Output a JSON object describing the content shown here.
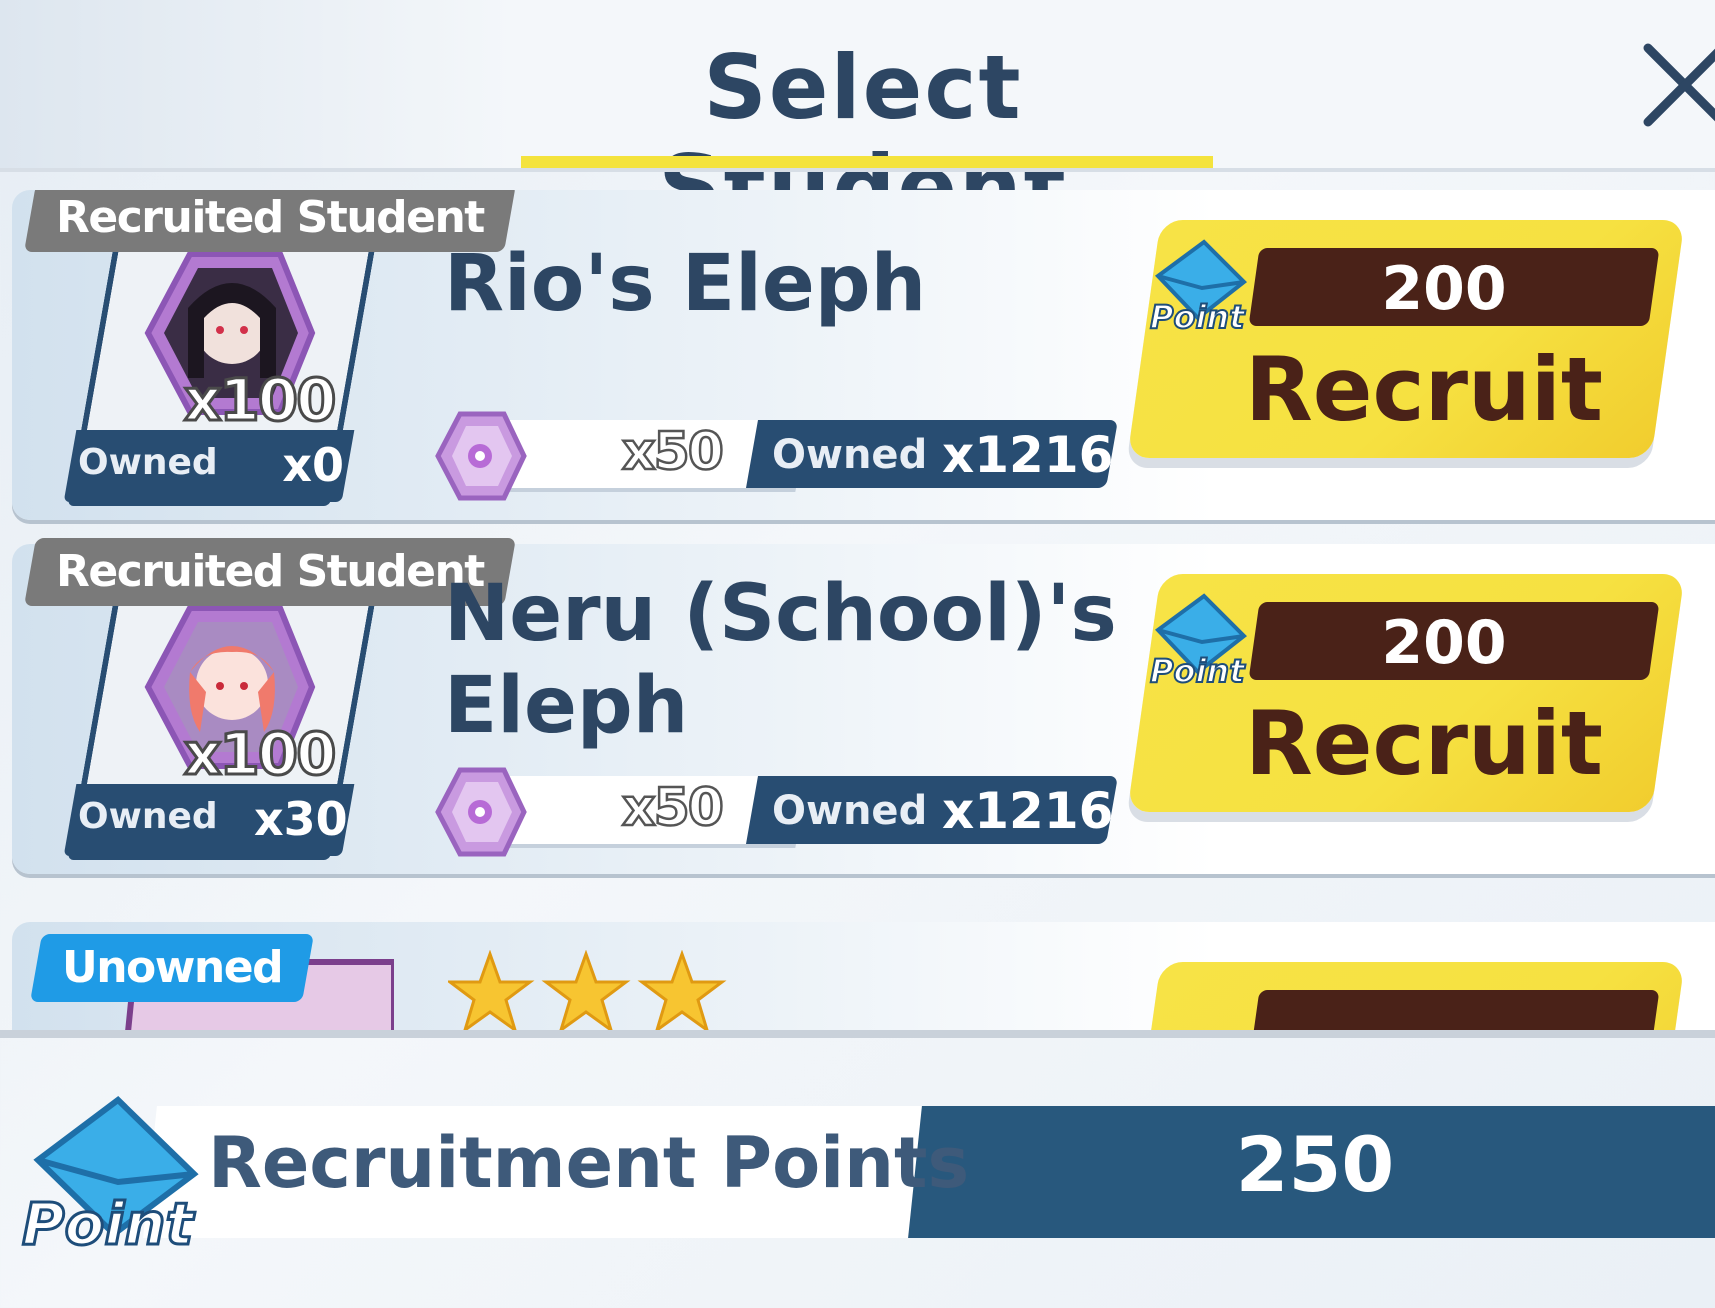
{
  "header": {
    "title": "Select Student"
  },
  "list": {
    "items": [
      {
        "tag": "Recruited Student",
        "name": "Rio's Eleph",
        "avatar_count": "x100",
        "owned_label": "Owned",
        "owned_value": "x0",
        "material_qty": "x50",
        "material_owned_label": "Owned",
        "material_owned_value": "x1216",
        "cost": "200",
        "button_label": "Recruit",
        "point_icon_text": "Point"
      },
      {
        "tag": "Recruited Student",
        "name_line1": "Neru (School)'s",
        "name_line2": "Eleph",
        "avatar_count": "x100",
        "owned_label": "Owned",
        "owned_value": "x30",
        "material_qty": "x50",
        "material_owned_label": "Owned",
        "material_owned_value": "x1216",
        "cost": "200",
        "button_label": "Recruit",
        "point_icon_text": "Point"
      },
      {
        "tag": "Unowned",
        "stars": 3
      }
    ]
  },
  "footer": {
    "label": "Recruitment Points",
    "value": "250",
    "icon_text": "Point"
  },
  "colors": {
    "navy": "#284d72",
    "title": "#2d4663",
    "accent_yellow": "#f4e33d",
    "button_yellow": "#f7e346",
    "cost_brown": "#4a2218",
    "tag_gray": "#7a7a7a",
    "tag_blue": "#1f9be6"
  },
  "icons": [
    "close-icon",
    "point-envelope-icon",
    "eleph-gem-icon",
    "star-icon",
    "student-portrait-icon"
  ]
}
